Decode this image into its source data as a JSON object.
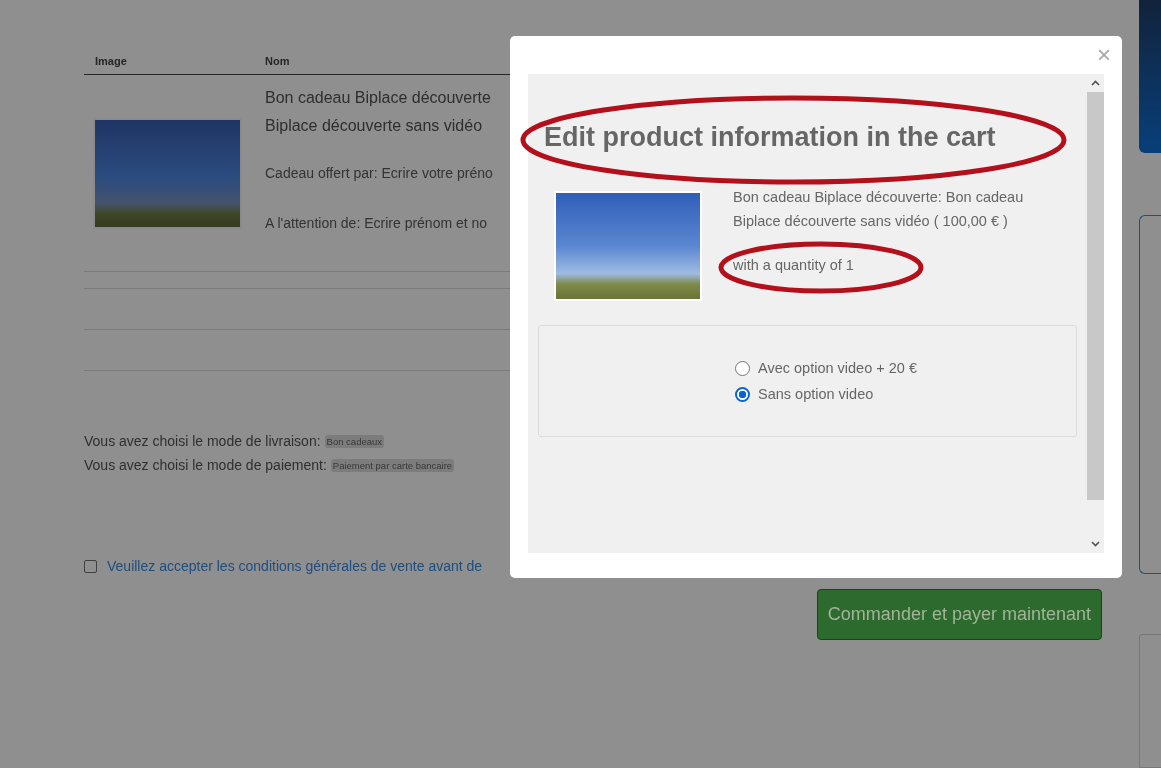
{
  "cart_table": {
    "columns": [
      "Image",
      "Nom"
    ],
    "rows": [
      {
        "name_lines": [
          "Bon cadeau Biplace découverte",
          "Biplace découverte sans vidéo"
        ],
        "details": [
          "Cadeau offert par: Ecrire votre préno",
          "A l'attention de: Ecrire prénom et no"
        ]
      }
    ]
  },
  "delivery": {
    "label": "Vous avez choisi le mode de livraison:",
    "value": "Bon cadeaux"
  },
  "payment": {
    "label": "Vous avez choisi le mode de paiement:",
    "value": "Paiement par carte bancaire"
  },
  "terms": {
    "label": "Veuillez accepter les conditions générales de vente avant de",
    "checked": false
  },
  "order_button": "Commander et payer maintenant",
  "modal": {
    "close": "×",
    "title": {
      "text": "Edit product information in the cart",
      "circled": true
    },
    "product": {
      "description": "Bon cadeau Biplace découverte: Bon cadeau Biplace découverte sans vidéo ( 100,00 € )",
      "quantity": {
        "text": "with a quantity of 1",
        "circled": true
      }
    },
    "options": [
      {
        "label": "Avec option video + 20 €",
        "selected": false
      },
      {
        "label": "Sans option video",
        "selected": true
      }
    ]
  }
}
